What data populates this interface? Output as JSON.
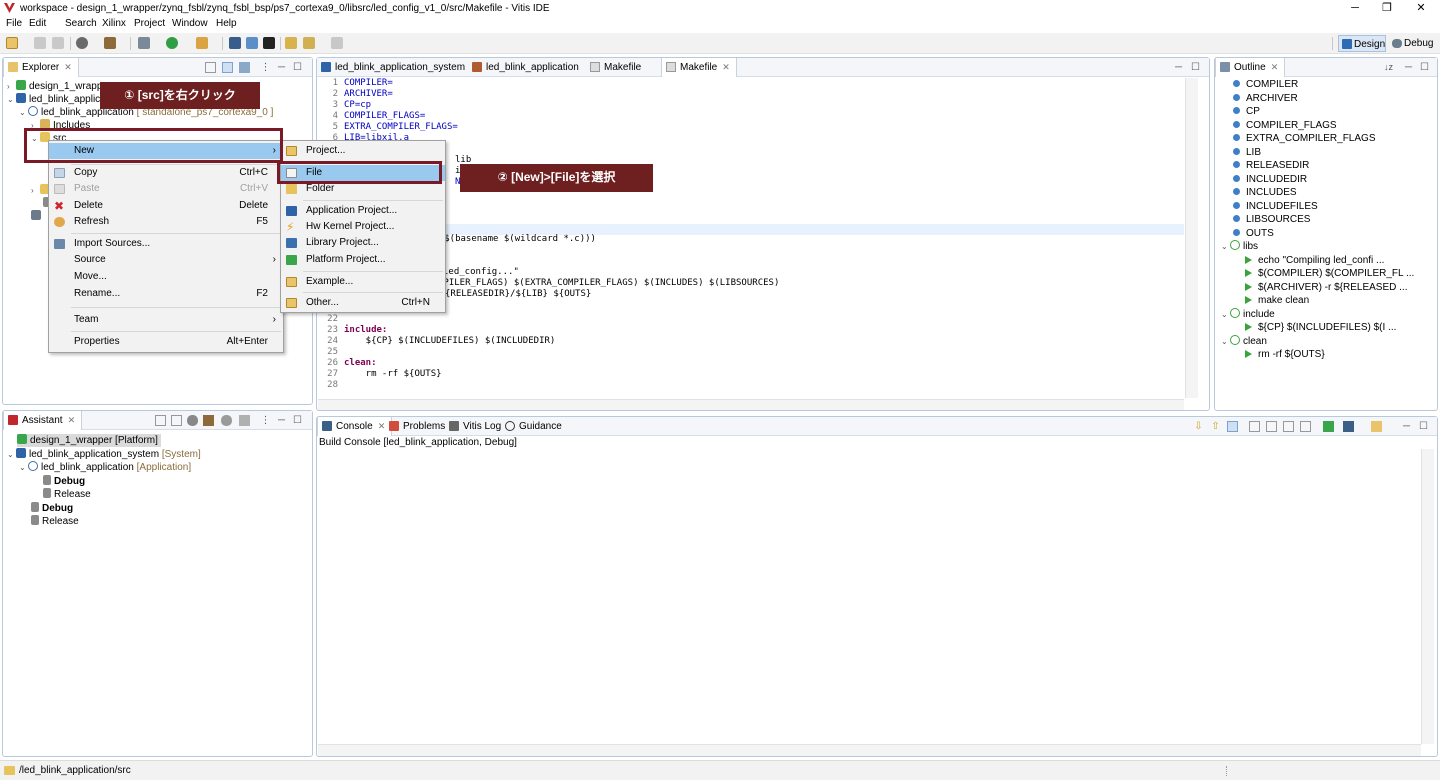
{
  "window": {
    "title": "workspace - design_1_wrapper/zynq_fsbl/zynq_fsbl_bsp/ps7_cortexa9_0/libsrc/led_config_v1_0/src/Makefile - Vitis IDE",
    "minimize": "─",
    "maximize": "❐",
    "close": "✕"
  },
  "menubar": [
    "File",
    "Edit",
    "Search",
    "Xilinx",
    "Project",
    "Window",
    "Help"
  ],
  "perspectives": {
    "design": "Design",
    "debug": "Debug"
  },
  "explorer": {
    "tab": "Explorer",
    "rows": [
      {
        "label": "design_1_wrappe",
        "extra": ""
      },
      {
        "label": "led_blink_applica",
        "extra": ""
      },
      {
        "label": "led_blink_application",
        "extra": "[ standalone_ps7_cortexa9_0 ]"
      },
      {
        "label": "Includes",
        "extra": ""
      },
      {
        "label": "src",
        "extra": ""
      }
    ]
  },
  "editor": {
    "tabs": [
      "led_blink_application_system",
      "led_blink_application",
      "Makefile",
      "Makefile"
    ],
    "lines": [
      {
        "n": "1",
        "t": "COMPILER="
      },
      {
        "n": "2",
        "t": "ARCHIVER="
      },
      {
        "n": "3",
        "t": "CP=cp"
      },
      {
        "n": "4",
        "t": "COMPILER_FLAGS="
      },
      {
        "n": "5",
        "t": "EXTRA_COMPILER_FLAGS="
      },
      {
        "n": "6",
        "t": "LIB=libxil.a"
      }
    ],
    "frag_lib": "lib",
    "frag_inc": "inc",
    "frag_incl": "NCL",
    "frag_basename": "o, $(basename $(wildcard *.c)))",
    "frag_echo": "led_config...\"",
    "frag_compile": "MPILER_FLAGS) $(EXTRA_COMPILER_FLAGS) $(INCLUDES) $(LIBSOURCES)",
    "frag_archive": "{RELEASEDIR}/${LIB} ${OUTS}",
    "tail_lines": [
      {
        "n": "22",
        "t": ""
      },
      {
        "n": "23",
        "t": "include:"
      },
      {
        "n": "24",
        "t": "    ${CP} $(INCLUDEFILES) $(INCLUDEDIR)"
      },
      {
        "n": "25",
        "t": ""
      },
      {
        "n": "26",
        "t": "clean:"
      },
      {
        "n": "27",
        "t": "    rm -rf ${OUTS}"
      },
      {
        "n": "28",
        "t": ""
      }
    ]
  },
  "outline": {
    "tab": "Outline",
    "vars": [
      "COMPILER",
      "ARCHIVER",
      "CP",
      "COMPILER_FLAGS",
      "EXTRA_COMPILER_FLAGS",
      "LIB",
      "RELEASEDIR",
      "INCLUDEDIR",
      "INCLUDES",
      "INCLUDEFILES",
      "LIBSOURCES",
      "OUTS"
    ],
    "libs": "libs",
    "libs_children": [
      "echo \"Compiling led_confi ...",
      "$(COMPILER) $(COMPILER_FL ...",
      "$(ARCHIVER) -r ${RELEASED ...",
      "make clean"
    ],
    "include": "include",
    "include_children": [
      "${CP} $(INCLUDEFILES) $(I ..."
    ],
    "clean": "clean",
    "clean_children": [
      "rm -rf ${OUTS}"
    ]
  },
  "context_menu": {
    "new": "New",
    "copy": "Copy",
    "copy_sc": "Ctrl+C",
    "paste": "Paste",
    "paste_sc": "Ctrl+V",
    "delete": "Delete",
    "delete_sc": "Delete",
    "refresh": "Refresh",
    "refresh_sc": "F5",
    "import": "Import Sources...",
    "source": "Source",
    "move": "Move...",
    "rename": "Rename...",
    "rename_sc": "F2",
    "team": "Team",
    "properties": "Properties",
    "properties_sc": "Alt+Enter"
  },
  "submenu": {
    "project": "Project...",
    "file": "File",
    "folder": "Folder",
    "app_project": "Application Project...",
    "hw_kernel": "Hw Kernel Project...",
    "library": "Library Project...",
    "platform": "Platform Project...",
    "example": "Example...",
    "other": "Other...",
    "other_sc": "Ctrl+N"
  },
  "callouts": {
    "one": "① [src]を右クリック",
    "two": "② [New]>[File]を選択"
  },
  "assistant": {
    "tab": "Assistant",
    "rows": [
      {
        "label": "design_1_wrapper [Platform]",
        "extra": ""
      },
      {
        "label": "led_blink_application_system",
        "extra": "[System]"
      },
      {
        "label": "led_blink_application",
        "extra": "[Application]"
      },
      {
        "label": "Debug",
        "extra": ""
      },
      {
        "label": "Release",
        "extra": ""
      },
      {
        "label": "Debug",
        "extra": ""
      },
      {
        "label": "Release",
        "extra": ""
      }
    ]
  },
  "console": {
    "tabs": [
      "Console",
      "Problems",
      "Vitis Log",
      "Guidance"
    ],
    "header": "Build Console [led_blink_application, Debug]"
  },
  "status": {
    "path": "/led_blink_application/src"
  },
  "colors": {
    "accent_red": "#7a1a26",
    "callout_bg": "#6e1f1f",
    "menu_highlight": "#99c9ef",
    "keyword": "#7f0055",
    "variable": "#0000c0"
  }
}
